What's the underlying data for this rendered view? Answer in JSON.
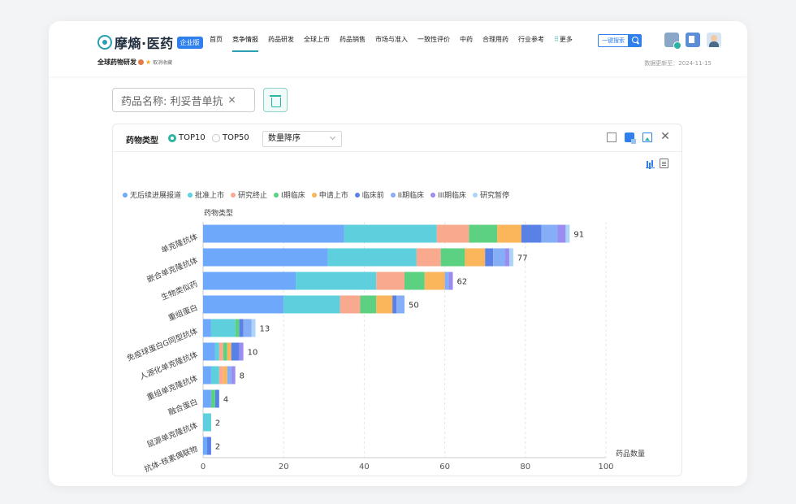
{
  "header": {
    "logo_text": "摩熵·医药",
    "logo_badge": "企业版",
    "nav": [
      "首页",
      "竞争情报",
      "药品研发",
      "全球上市",
      "药品销售",
      "市场与准入",
      "一致性评价",
      "中药",
      "合理用药",
      "行业参考",
      "更多"
    ],
    "active_nav": "竞争情报",
    "search_label": "一键搜索",
    "page_title": "全球药物研发",
    "unfavorite_label": "取消收藏",
    "update_time": "数据更新至：2024-11-15"
  },
  "filter": {
    "tag_text": "药品名称: 利妥昔单抗"
  },
  "panel": {
    "title": "药物类型",
    "radio_options": [
      "TOP10",
      "TOP50"
    ],
    "selected_radio": "TOP10",
    "sort_value": "数量降序"
  },
  "chart_data": {
    "type": "bar",
    "orientation": "horizontal",
    "stacked": true,
    "ylabel": "药物类型",
    "xlabel": "药品数量",
    "xlim": [
      0,
      100
    ],
    "x_ticks": [
      0,
      20,
      40,
      60,
      80,
      100
    ],
    "grid": "vertical-dashed",
    "legend_position": "top",
    "categories": [
      "单克隆抗体",
      "嵌合单克隆抗体",
      "生物类似药",
      "重组蛋白",
      "免疫球蛋白G同型抗体",
      "人源化单克隆抗体",
      "重组单克隆抗体",
      "融合蛋白",
      "鼠源单克隆抗体",
      "抗体-核素偶联物"
    ],
    "totals": [
      91,
      77,
      62,
      50,
      13,
      10,
      8,
      4,
      2,
      2
    ],
    "series": [
      {
        "name": "无后续进展报道",
        "color": "#6ea8fb",
        "values": [
          35,
          31,
          23,
          20,
          2,
          3,
          2,
          2,
          0,
          1
        ]
      },
      {
        "name": "批准上市",
        "color": "#5ecfdc",
        "values": [
          23,
          22,
          20,
          14,
          6,
          1,
          2,
          0,
          2,
          0
        ]
      },
      {
        "name": "研究终止",
        "color": "#f9a98e",
        "values": [
          8,
          6,
          7,
          5,
          0,
          1,
          1,
          0,
          0,
          0
        ]
      },
      {
        "name": "I期临床",
        "color": "#5bd181",
        "values": [
          7,
          6,
          5,
          4,
          1,
          1,
          0,
          1,
          0,
          0
        ]
      },
      {
        "name": "申请上市",
        "color": "#fbb65b",
        "values": [
          6,
          5,
          5,
          4,
          0,
          1,
          1,
          0,
          0,
          0
        ]
      },
      {
        "name": "临床前",
        "color": "#5a82e6",
        "values": [
          5,
          2,
          0,
          1,
          1,
          2,
          0,
          1,
          0,
          1
        ]
      },
      {
        "name": "II期临床",
        "color": "#86aef6",
        "values": [
          4,
          3,
          1,
          2,
          2,
          0,
          1,
          0,
          0,
          0
        ]
      },
      {
        "name": "III期临床",
        "color": "#9b8cf0",
        "values": [
          2,
          1,
          1,
          0,
          0,
          1,
          1,
          0,
          0,
          0
        ]
      },
      {
        "name": "研究暂停",
        "color": "#acd3f8",
        "values": [
          1,
          1,
          0,
          0,
          1,
          0,
          0,
          0,
          0,
          0
        ]
      }
    ]
  }
}
